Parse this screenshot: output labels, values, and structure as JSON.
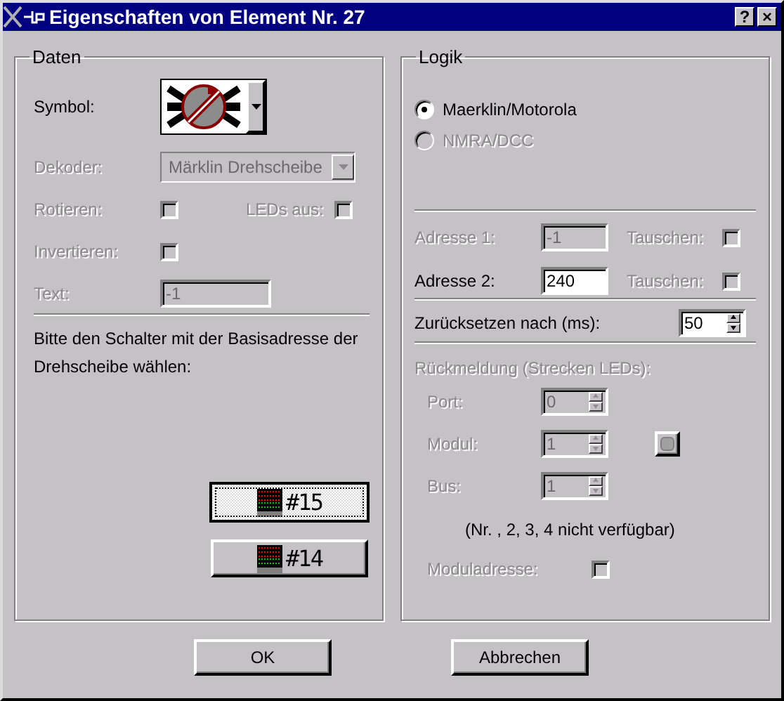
{
  "window": {
    "title": "Eigenschaften von Element Nr. 27",
    "help_button": "?",
    "close_button": "×"
  },
  "daten": {
    "title": "Daten",
    "symbol": {
      "label": "Symbol:"
    },
    "decoder": {
      "label": "Dekoder:",
      "value": "Märklin Drehscheibe",
      "disabled": true
    },
    "rotate": {
      "label": "Rotieren:",
      "checked": false,
      "disabled": true
    },
    "leds_off": {
      "label": "LEDs aus:",
      "checked": false,
      "disabled": true
    },
    "invert": {
      "label": "Invertieren:",
      "checked": false,
      "disabled": true
    },
    "text": {
      "label": "Text:",
      "value": "-1",
      "disabled": true
    },
    "instruction": "Bitte den Schalter mit der Basisadresse der Drehscheibe wählen:",
    "switches": [
      {
        "label": "#15",
        "selected": true
      },
      {
        "label": "#14",
        "selected": false
      }
    ]
  },
  "logik": {
    "title": "Logik",
    "protocols": [
      {
        "label": "Maerklin/Motorola",
        "selected": true,
        "disabled": false
      },
      {
        "label": "NMRA/DCC",
        "selected": false,
        "disabled": true
      }
    ],
    "addresses": [
      {
        "label": "Adresse 1:",
        "value": "-1",
        "disabled": true,
        "swap": {
          "label": "Tauschen:",
          "checked": false,
          "disabled": true
        }
      },
      {
        "label": "Adresse 2:",
        "value": "240",
        "disabled": false,
        "swap": {
          "label": "Tauschen:",
          "checked": false,
          "disabled": true
        }
      }
    ],
    "reset": {
      "label": "Zurücksetzen nach (ms):",
      "value": "50"
    },
    "feedback": {
      "title": "Rückmeldung (Strecken LEDs):",
      "disabled": true,
      "fields": [
        {
          "label": "Port:",
          "value": "0",
          "test_button": false
        },
        {
          "label": "Modul:",
          "value": "1",
          "test_button": true
        },
        {
          "label": "Bus:",
          "value": "1",
          "test_button": false
        }
      ],
      "note": "(Nr. , 2, 3, 4 nicht verfügbar)",
      "module_address": {
        "label": "Moduladresse:",
        "checked": false,
        "disabled": true
      }
    }
  },
  "buttons": [
    "OK",
    "Abbrechen"
  ]
}
